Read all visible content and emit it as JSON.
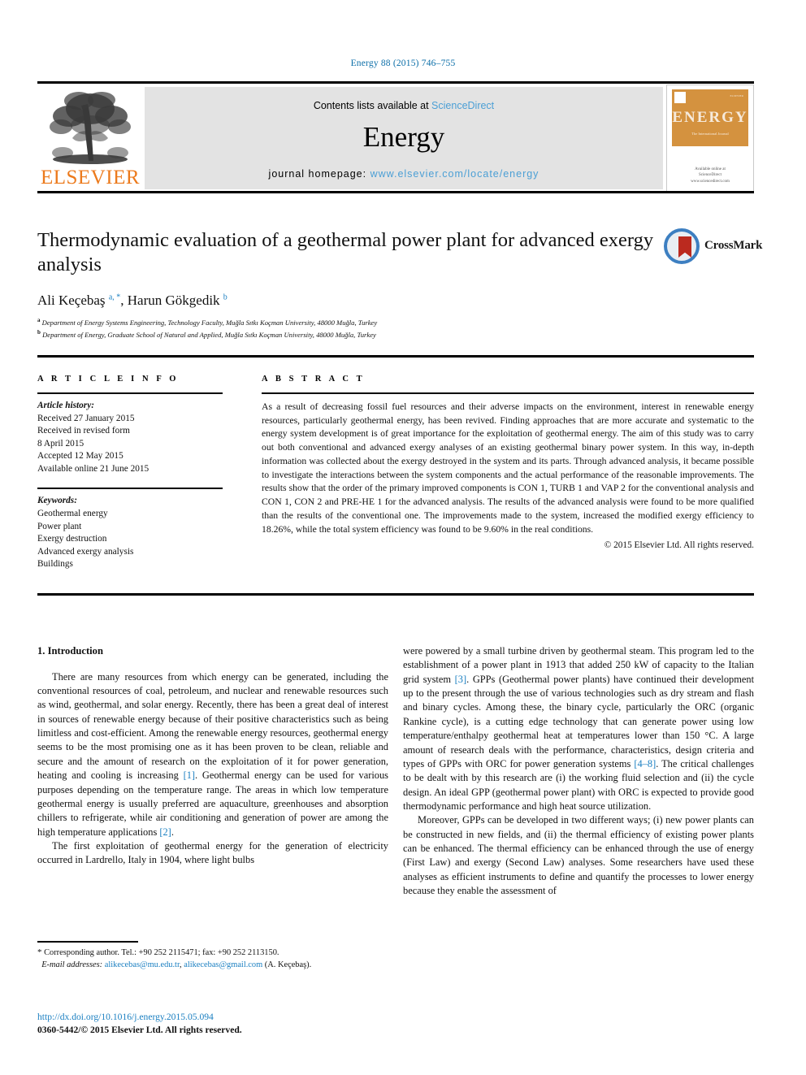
{
  "running_head": "Energy 88 (2015) 746–755",
  "masthead": {
    "publisher_logo_text": "ELSEVIER",
    "contents_prefix": "Contents lists available at ",
    "contents_link": "ScienceDirect",
    "journal_title": "Energy",
    "homepage_prefix": "journal homepage: ",
    "homepage_url": "www.elsevier.com/locate/energy",
    "cover": {
      "title": "ENERGY",
      "subtitle": "The International Journal",
      "footer_line1": "Available online at",
      "footer_line2": "ScienceDirect",
      "footer_line3": "www.sciencedirect.com",
      "corner_mark": "ELSEVIER"
    }
  },
  "article": {
    "title": "Thermodynamic evaluation of a geothermal power plant for advanced exergy analysis",
    "crossmark_label": "CrossMark",
    "authors_html": "Ali Keçebaş <sup>a, *</sup>, Harun Gökgedik <sup>b</sup>",
    "affiliation_a": "Department of Energy Systems Engineering, Technology Faculty, Muğla Sıtkı Koçman University, 48000 Muğla, Turkey",
    "affiliation_b": "Department of Energy, Graduate School of Natural and Applied, Muğla Sıtkı Koçman University, 48000 Muğla, Turkey"
  },
  "article_info": {
    "heading": "A R T I C L E  I N F O",
    "history_label": "Article history:",
    "history_lines": [
      "Received 27 January 2015",
      "Received in revised form",
      "8 April 2015",
      "Accepted 12 May 2015",
      "Available online 21 June 2015"
    ],
    "keywords_label": "Keywords:",
    "keywords": [
      "Geothermal energy",
      "Power plant",
      "Exergy destruction",
      "Advanced exergy analysis",
      "Buildings"
    ]
  },
  "abstract": {
    "heading": "A B S T R A C T",
    "text": "As a result of decreasing fossil fuel resources and their adverse impacts on the environment, interest in renewable energy resources, particularly geothermal energy, has been revived. Finding approaches that are more accurate and systematic to the energy system development is of great importance for the exploitation of geothermal energy. The aim of this study was to carry out both conventional and advanced exergy analyses of an existing geothermal binary power system. In this way, in-depth information was collected about the exergy destroyed in the system and its parts. Through advanced analysis, it became possible to investigate the interactions between the system components and the actual performance of the reasonable improvements. The results show that the order of the primary improved components is CON 1, TURB 1 and VAP 2 for the conventional analysis and CON 1, CON 2 and PRE-HE 1 for the advanced analysis. The results of the advanced analysis were found to be more qualified than the results of the conventional one. The improvements made to the system, increased the modified exergy efficiency to 18.26%, while the total system efficiency was found to be 9.60% in the real conditions.",
    "copyright": "© 2015 Elsevier Ltd. All rights reserved."
  },
  "body": {
    "section_heading": "1. Introduction",
    "left_paragraph_1_a": "There are many resources from which energy can be generated, including the conventional resources of coal, petroleum, and nuclear and renewable resources such as wind, geothermal, and solar energy. Recently, there has been a great deal of interest in sources of renewable energy because of their positive characteristics such as being limitless and cost-efficient. Among the renewable energy resources, geothermal energy seems to be the most promising one as it has been proven to be clean, reliable and secure and the amount of research on the exploitation of it for power generation, heating and cooling is increasing ",
    "ref_1": "[1]",
    "left_paragraph_1_b": ". Geothermal energy can be used for various purposes depending on the temperature range. The areas in which low temperature geothermal energy is usually preferred are aquaculture, greenhouses and absorption chillers to refrigerate, while air conditioning and generation of power are among the high temperature applications ",
    "ref_2": "[2]",
    "left_paragraph_1_c": ".",
    "left_paragraph_2": "The first exploitation of geothermal energy for the generation of electricity occurred in Lardrello, Italy in 1904, where light bulbs",
    "right_paragraph_1_a": "were powered by a small turbine driven by geothermal steam. This program led to the establishment of a power plant in 1913 that added 250 kW of capacity to the Italian grid system ",
    "ref_3": "[3]",
    "right_paragraph_1_b": ". GPPs (Geothermal power plants) have continued their development up to the present through the use of various technologies such as dry stream and flash and binary cycles. Among these, the binary cycle, particularly the ORC (organic Rankine cycle), is a cutting edge technology that can generate power using low temperature/enthalpy geothermal heat at temperatures lower than 150 °C. A large amount of research deals with the performance, characteristics, design criteria and types of GPPs with ORC for power generation systems ",
    "ref_4_8": "[4–8]",
    "right_paragraph_1_c": ". The critical challenges to be dealt with by this research are (i) the working fluid selection and (ii) the cycle design. An ideal GPP (geothermal power plant) with ORC is expected to provide good thermodynamic performance and high heat source utilization.",
    "right_paragraph_2": "Moreover, GPPs can be developed in two different ways; (i) new power plants can be constructed in new fields, and (ii) the thermal efficiency of existing power plants can be enhanced. The thermal efficiency can be enhanced through the use of energy (First Law) and exergy (Second Law) analyses. Some researchers have used these analyses as efficient instruments to define and quantify the processes to lower energy because they enable the assessment of"
  },
  "footnotes": {
    "corresponding_marker": "*",
    "corresponding_text": " Corresponding author. Tel.: +90 252 2115471; fax: +90 252 2113150.",
    "email_label": "E-mail addresses:",
    "email_1": "alikecebas@mu.edu.tr",
    "email_2": "alikecebas@gmail.com",
    "email_suffix": " (A. Keçebaş).",
    "doi": "http://dx.doi.org/10.1016/j.energy.2015.05.094",
    "issn_line": "0360-5442/© 2015 Elsevier Ltd. All rights reserved."
  },
  "colors": {
    "link_blue": "#1a7fc1",
    "header_blue": "#0b6ea8",
    "sciencedirect_blue": "#4b9fd5",
    "elsevier_orange": "#ec7a1c",
    "cover_orange": "#d4923f",
    "crossmark_blue": "#3d7fc1",
    "crossmark_red": "#bb2a1f",
    "banner_gray": "#e3e3e3"
  }
}
